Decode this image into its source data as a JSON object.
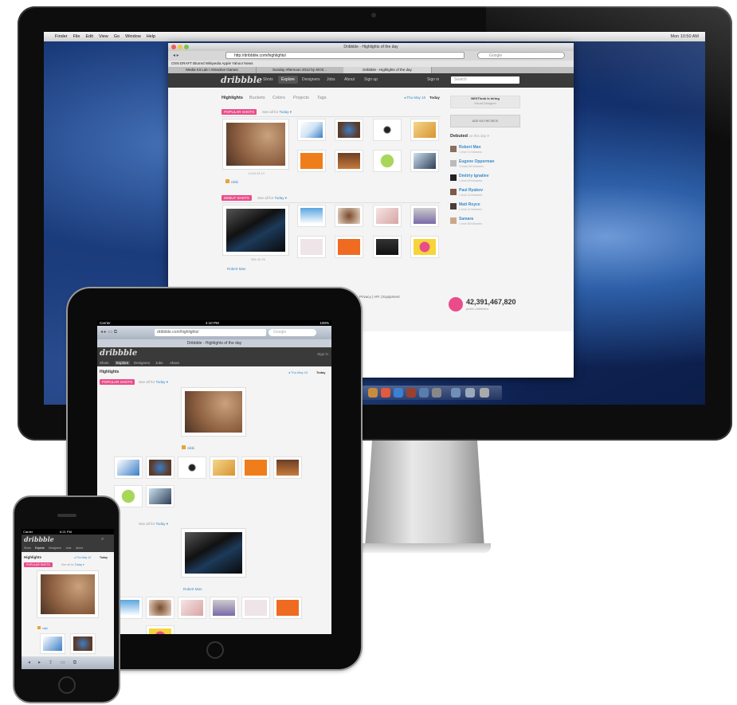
{
  "mac": {
    "menubar": [
      "Finder",
      "File",
      "Edit",
      "View",
      "Go",
      "Window",
      "Help"
    ],
    "clock": "Mon 10:50 AM",
    "browser_title": "Dribbble - Highlights of the day",
    "url": "http://dribbble.com/highlights/",
    "search_placeholder": "Google",
    "bookmarks": "CNN  DRAFT  Blurred  Wikipedia  Apple  Yahoo!  News",
    "tabs": [
      "Media Kit Lab / Attractive Games",
      "Sunday Afternoon 2012 by SiO2...",
      "Dribbble - Highlights of the day"
    ]
  },
  "dribbble": {
    "logo": "dribbble",
    "nav": [
      "Shots",
      "Explore",
      "Designers",
      "Jobs",
      "About"
    ],
    "signup": "Sign up",
    "signin": "Sign in",
    "search_placeholder": "Search",
    "subnav": [
      "Highlights",
      "Buckets",
      "Colors",
      "Projects",
      "Tags"
    ],
    "date_prev": "◂ Thu May 10",
    "date_today": "Today",
    "popular_tag": "POPULAR SHOTS",
    "popular_seeall": "See all for",
    "popular_seeall_link": "Today ▾",
    "debut_tag": "DEBUT SHOTS",
    "debut_seeall": "See all for",
    "debut_seeall_link": "Today ▾",
    "popular_player": "nikki",
    "popular_stats": "1,633   48   12",
    "debut_player": "Robert Man",
    "debut_stats": "586   46   26",
    "sidebar_hiring": "NEXTlook is hiring",
    "sidebar_hiring_sub": "Visual Designer",
    "sidebar_ad": "ADD VIA THE DECK",
    "debuted_title": "Debuted",
    "debuted_sub": "on this day ▾",
    "debuted": [
      {
        "name": "Robert Man",
        "stats": "1 shot   11 followers"
      },
      {
        "name": "Eugene Opperman",
        "stats": "3 shots   56 followers"
      },
      {
        "name": "Dmitriy Ignatiev",
        "stats": "1 shot   48 followers"
      },
      {
        "name": "Paul Ryabov",
        "stats": "1 shot   14 followers"
      },
      {
        "name": "Matt Royce",
        "stats": "1 shot   12 followers"
      },
      {
        "name": "Samara",
        "stats": "1 shot   38 followers"
      }
    ],
    "footer_links": "Privacy  |  API  |  Equipment",
    "shots_count": "42,391,467,820",
    "shots_label": "pixels dribbbled"
  },
  "ipad": {
    "carrier": "Carrier",
    "time": "4:10 PM",
    "battery": "100%",
    "url": "dribbble.com/highlights/",
    "search_placeholder": "Google",
    "page_title": "Dribbble - Highlights of the day",
    "logo": "dribbble",
    "nav": [
      "Shots",
      "Explore",
      "Designers",
      "Jobs",
      "About"
    ],
    "signin": "Sign in",
    "section": "Highlights",
    "date_prev": "◂ Thu May 10",
    "date_today": "Today",
    "popular_tag": "POPULAR SHOTS",
    "seeall": "See all for",
    "seeall_link": "Today ▾",
    "debut_seeall": "See all for",
    "debut_seeall_link": "Today ▾",
    "popular_player": "nikki",
    "debut_player": "Robert Man"
  },
  "iphone": {
    "carrier": "Carrier",
    "time": "6:21 PM",
    "logo": "dribbble",
    "nav": [
      "Shots",
      "Explore",
      "Designers",
      "Jobs",
      "About"
    ],
    "section": "Highlights",
    "date_prev": "◂ Thu May 10",
    "date_today": "Today",
    "popular_tag": "POPULAR SHOTS",
    "seeall": "See all for",
    "seeall_link": "Today ▾",
    "popular_player": "nikki"
  },
  "colors": {
    "accent": "#ea4c89",
    "link": "#3a8ac7",
    "header": "#3a3a3a"
  }
}
